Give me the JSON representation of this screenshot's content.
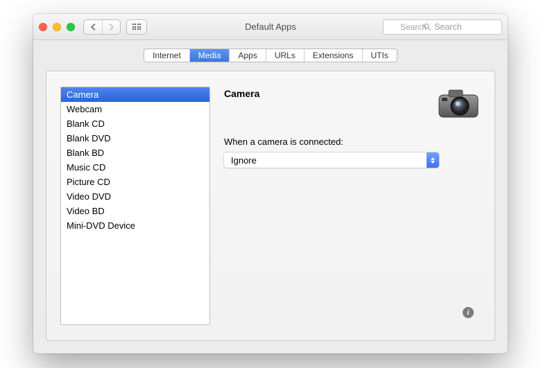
{
  "window": {
    "title": "Default Apps"
  },
  "search": {
    "placeholder": "Search"
  },
  "tabs": {
    "items": [
      {
        "label": "Internet"
      },
      {
        "label": "Media"
      },
      {
        "label": "Apps"
      },
      {
        "label": "URLs"
      },
      {
        "label": "Extensions"
      },
      {
        "label": "UTIs"
      }
    ],
    "selected_index": 1
  },
  "media_list": {
    "selected_index": 0,
    "items": [
      "Camera",
      "Webcam",
      "Blank CD",
      "Blank DVD",
      "Blank BD",
      "Music CD",
      "Picture CD",
      "Video DVD",
      "Video BD",
      "Mini-DVD Device"
    ]
  },
  "detail": {
    "title": "Camera",
    "prompt": "When a camera is connected:",
    "action_selected": "Ignore",
    "icon": "camera-icon"
  }
}
